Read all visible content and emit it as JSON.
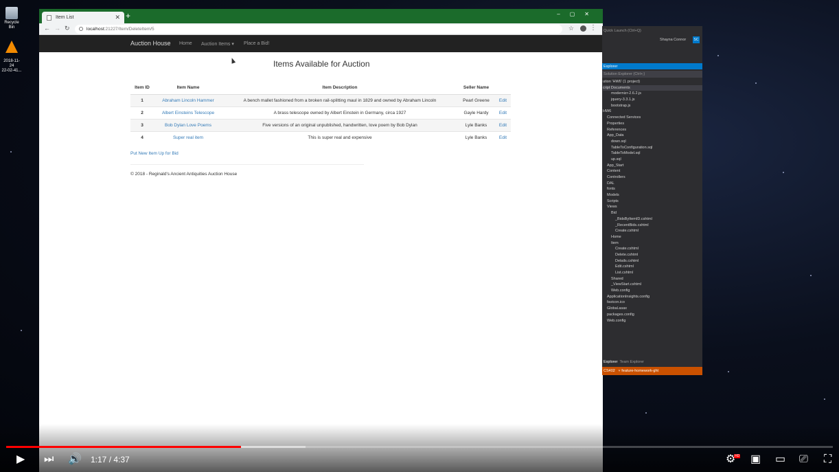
{
  "desktop": {
    "icons": [
      {
        "label": "Recycle Bin",
        "icon": "recycle-bin-icon"
      },
      {
        "label": "2018-11-24\n22-02-41...",
        "icon": "vlc-icon"
      }
    ]
  },
  "browser": {
    "tab_title": "Item List",
    "url_host": "localhost:",
    "url_rest": "21227/Item/DeleteItem/5"
  },
  "site": {
    "brand": "Auction House",
    "nav": [
      "Home",
      "Auction Items ▾",
      "Place a Bid!"
    ],
    "heading": "Items Available for Auction",
    "table": {
      "headers": [
        "Item ID",
        "Item Name",
        "Item Description",
        "Seller Name",
        ""
      ],
      "rows": [
        {
          "id": "1",
          "name": "Abraham Lincoln Hammer",
          "description": "A bench mallet fashioned from a broken rail-splitting maul in 1829 and owned by Abraham Lincoln",
          "seller": "Pearl Greene",
          "action": "Edit"
        },
        {
          "id": "2",
          "name": "Albert Einsteins Telescope",
          "description": "A brass telescope owned by Albert Einstein in Germany, circa 1927",
          "seller": "Gayle Hardy",
          "action": "Edit"
        },
        {
          "id": "3",
          "name": "Bob Dylan Love Poems",
          "description": "Five versions of an original unpublished, handwritten, love poem by Bob Dylan",
          "seller": "Lyle Banks",
          "action": "Edit"
        },
        {
          "id": "4",
          "name": "Super real item",
          "description": "This is super real and expensive",
          "seller": "Lyle Banks",
          "action": "Edit"
        }
      ]
    },
    "put_link": "Put New Item Up for Bid",
    "footer": "© 2018 - Reginald's Ancient Antiquities Auction House"
  },
  "vs": {
    "quick_launch": "Quick Launch (Ctrl+Q)",
    "user": "Shayna Connor",
    "user_initials": "SC",
    "panel_title": "Explorer",
    "search": "Solution Explorer (Ctrl+;)",
    "tree": [
      "ution 'HW6' (1 project)",
      "cript Documents",
      "modernizr-2.6.2.js",
      "jquery-3.3.1.js",
      "bootstrap.js",
      "HW6",
      "Connected Services",
      "Properties",
      "References",
      "App_Data",
      "down.sql",
      "TableToConfiguration.sql",
      "TableToModel.sql",
      "up.sql",
      "App_Start",
      "Content",
      "Controllers",
      "DAL",
      "fonts",
      "Models",
      "Scripts",
      "Views",
      "Bid",
      "_BidsByItemID.cshtml",
      "_RecentBids.cshtml",
      "Create.cshtml",
      "Home",
      "Item",
      "Create.cshtml",
      "Delete.cshtml",
      "Details.cshtml",
      "Edit.cshtml",
      "List.cshtml",
      "Shared",
      "_ViewStart.cshtml",
      "Web.config",
      "ApplicationInsights.config",
      "favicon.ico",
      "Global.asax",
      "packages.config",
      "Web.config"
    ],
    "tab_active": "Explorer",
    "tab_other": "Team Explorer",
    "status_left": "CS402",
    "status_branch": "feature-homework-ght"
  },
  "video": {
    "time": "1:17 / 4:37",
    "played_fraction": 0.284,
    "buffered_fraction": 0.362,
    "hd_badge": "HD"
  }
}
